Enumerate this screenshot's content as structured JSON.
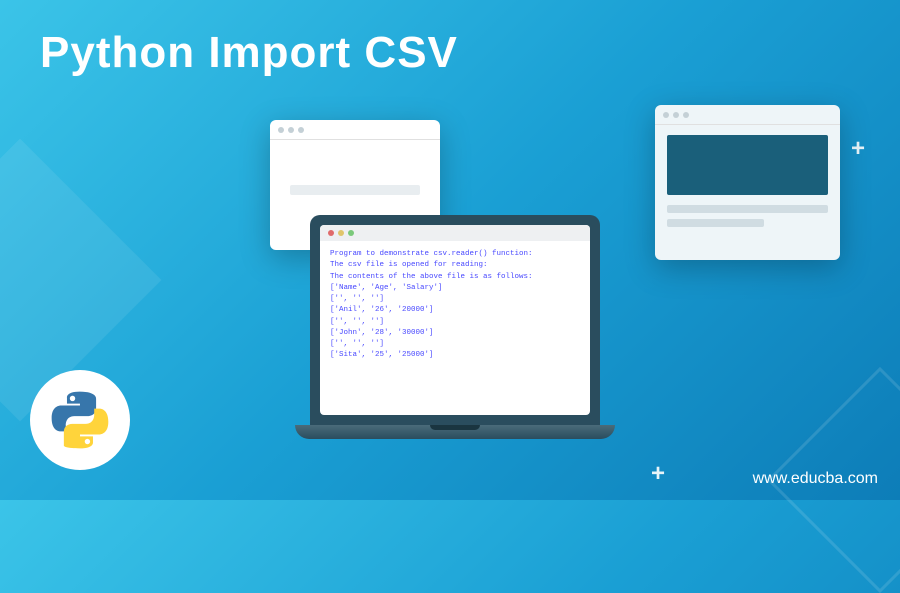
{
  "title": "Python Import CSV",
  "website": "www.educba.com",
  "code": {
    "line1": "Program to demonstrate csv.reader() function:",
    "line2": "",
    "line3": "The csv file is opened for reading:",
    "line4": "",
    "line5": "The contents of the above file is as follows:",
    "row1": "['Name', 'Age', 'Salary']",
    "row2": "['', '', '']",
    "row3": "['Anil', '26', '20000']",
    "row4": "['', '', '']",
    "row5": "['John', '28', '30000']",
    "row6": "['', '', '']",
    "row7": "['Sita', '25', '25000']"
  }
}
